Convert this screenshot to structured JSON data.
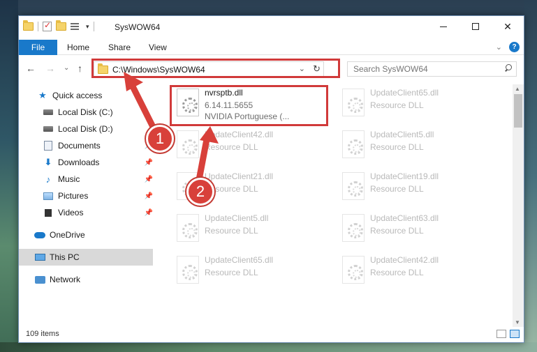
{
  "window": {
    "title": "SysWOW64"
  },
  "ribbon": {
    "tabs": [
      "File",
      "Home",
      "Share",
      "View"
    ]
  },
  "nav": {
    "address": "C:\\Windows\\SysWOW64",
    "search_placeholder": "Search SysWOW64"
  },
  "sidebar": {
    "items": [
      {
        "label": "Quick access",
        "icon": "star-icon",
        "pinned": false
      },
      {
        "label": "Local Disk (C:)",
        "icon": "disk-icon",
        "pinned": false
      },
      {
        "label": "Local Disk (D:)",
        "icon": "disk-icon",
        "pinned": false
      },
      {
        "label": "Documents",
        "icon": "document-icon",
        "pinned": true
      },
      {
        "label": "Downloads",
        "icon": "download-icon",
        "pinned": true
      },
      {
        "label": "Music",
        "icon": "music-icon",
        "pinned": true
      },
      {
        "label": "Pictures",
        "icon": "picture-icon",
        "pinned": true
      },
      {
        "label": "Videos",
        "icon": "video-icon",
        "pinned": true
      },
      {
        "label": "OneDrive",
        "icon": "cloud-icon",
        "pinned": false
      },
      {
        "label": "This PC",
        "icon": "pc-icon",
        "pinned": false,
        "selected": true
      },
      {
        "label": "Network",
        "icon": "network-icon",
        "pinned": false
      }
    ]
  },
  "files": [
    {
      "name": "nvrsptb.dll",
      "line2": "6.14.11.5655",
      "line3": "NVIDIA Portuguese (...",
      "highlight": true
    },
    {
      "name": "UpdateClient65.dll",
      "line2": "Resource DLL"
    },
    {
      "name": "UpdateClient42.dll",
      "line2": "Resource DLL"
    },
    {
      "name": "UpdateClient5.dll",
      "line2": "Resource DLL"
    },
    {
      "name": "UpdateClient21.dll",
      "line2": "Resource DLL"
    },
    {
      "name": "UpdateClient19.dll",
      "line2": "Resource DLL"
    },
    {
      "name": "UpdateClient5.dll",
      "line2": "Resource DLL"
    },
    {
      "name": "UpdateClient63.dll",
      "line2": "Resource DLL"
    },
    {
      "name": "UpdateClient65.dll",
      "line2": "Resource DLL"
    },
    {
      "name": "UpdateClient42.dll",
      "line2": "Resource DLL"
    }
  ],
  "status": {
    "count": "109 items"
  },
  "annotations": {
    "step1": "1",
    "step2": "2"
  },
  "colors": {
    "accent": "#1979ca",
    "annotation": "#d13a3a"
  }
}
